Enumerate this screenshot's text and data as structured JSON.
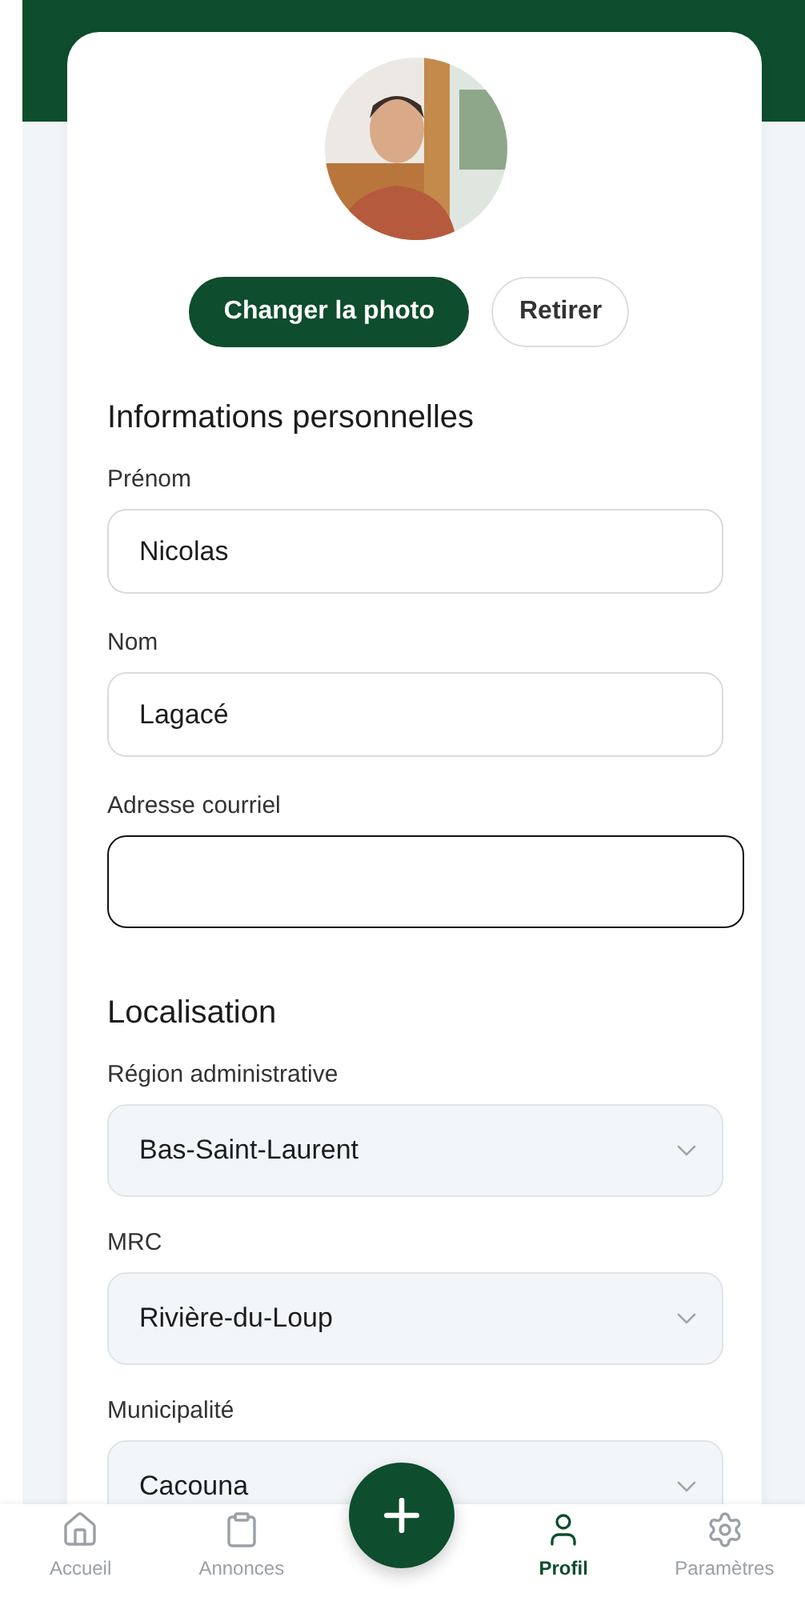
{
  "photo_buttons": [
    {
      "label": "Changer la photo",
      "kind": "primary"
    },
    {
      "label": "Retirer",
      "kind": "secondary"
    }
  ],
  "sections": [
    {
      "title": "Informations personnelles",
      "fields": [
        {
          "label": "Prénom",
          "kind": "input",
          "value": "Nicolas",
          "focused": false
        },
        {
          "label": "Nom",
          "kind": "input",
          "value": "Lagacé",
          "focused": false
        },
        {
          "label": "Adresse courriel",
          "kind": "input",
          "focused": true
        }
      ]
    },
    {
      "title": "Localisation",
      "fields": [
        {
          "label": "Région administrative",
          "kind": "select",
          "value": "Bas-Saint-Laurent"
        },
        {
          "label": "MRC",
          "kind": "select",
          "value": "Rivière-du-Loup"
        },
        {
          "label": "Municipalité",
          "kind": "select",
          "value": "Cacouna"
        }
      ]
    }
  ],
  "nav": [
    {
      "label": "Accueil",
      "kind": "tab",
      "selected": false
    },
    {
      "label": "Annonces",
      "kind": "tab",
      "selected": false
    },
    {
      "kind": "add"
    },
    {
      "label": "Profil",
      "kind": "tab",
      "selected": true
    },
    {
      "label": "Paramètres",
      "kind": "tab",
      "selected": false
    }
  ]
}
